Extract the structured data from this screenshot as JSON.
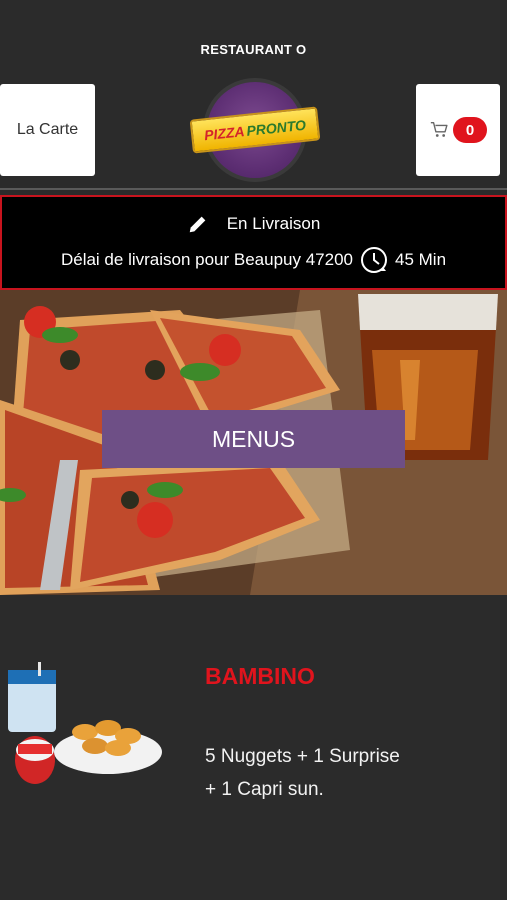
{
  "header": {
    "title": "RESTAURANT O",
    "carte_label": "La Carte",
    "cart_count": "0"
  },
  "logo": {
    "word1": "PIZZA",
    "word2": "PRONTO"
  },
  "delivery": {
    "mode": "En Livraison",
    "delay_text": "Délai de livraison pour Beaupuy 47200",
    "time": "45 Min"
  },
  "hero": {
    "button_label": "MENUS"
  },
  "product": {
    "name": "BAMBINO",
    "description": "5 Nuggets  + 1 Surprise  + 1 Capri sun."
  },
  "colors": {
    "accent_red": "#e0141d",
    "menus_purple": "#6e4f86",
    "background": "#2b2b2b"
  },
  "icons": [
    "pencil-icon",
    "clock-icon",
    "cart-icon"
  ]
}
